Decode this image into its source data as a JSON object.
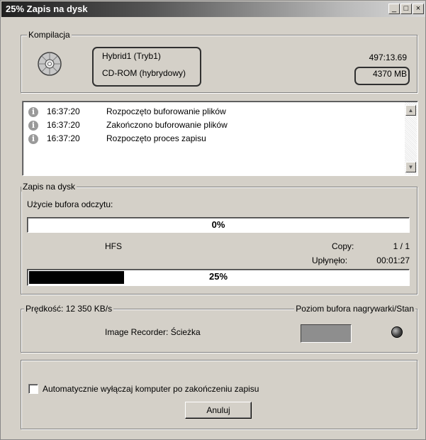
{
  "window": {
    "title": "25% Zapis na dysk",
    "minimize_glyph": "_",
    "maximize_glyph": "□",
    "close_glyph": "×"
  },
  "compilation": {
    "legend": "Kompilacja",
    "name": "Hybrid1 (Tryb1)",
    "type": "CD-ROM (hybrydowy)",
    "duration": "497:13.69",
    "size": "4370 MB",
    "icon": "cd-disc-icon"
  },
  "log": {
    "icon": "info-icon",
    "entries": [
      {
        "time": "16:37:20",
        "message": "Rozpoczęto buforowanie plików"
      },
      {
        "time": "16:37:20",
        "message": "Zakończono buforowanie plików"
      },
      {
        "time": "16:37:20",
        "message": "Rozpoczęto proces zapisu"
      }
    ]
  },
  "write": {
    "legend": "Zapis na dysk",
    "buffer_label": "Użycie bufora odczytu:",
    "buffer_percent_text": "0%",
    "buffer_fraction": 0.0,
    "fs_label": "HFS",
    "copy_label": "Copy:",
    "copy_value": "1 / 1",
    "elapsed_label": "Upłynęło:",
    "elapsed_value": "00:01:27",
    "progress_percent_text": "25%",
    "progress_fraction": 0.25
  },
  "speed": {
    "legend_left": "Prędkość: 12 350 KB/s",
    "legend_right": "Poziom bufora nagrywarki/Stan",
    "recorder_text": "Image Recorder: Ścieżka",
    "led_color": "#3a3a3a"
  },
  "footer": {
    "checkbox_label": "Automatycznie wyłączaj komputer po zakończeniu zapisu",
    "checkbox_checked": false,
    "cancel_label": "Anuluj"
  }
}
